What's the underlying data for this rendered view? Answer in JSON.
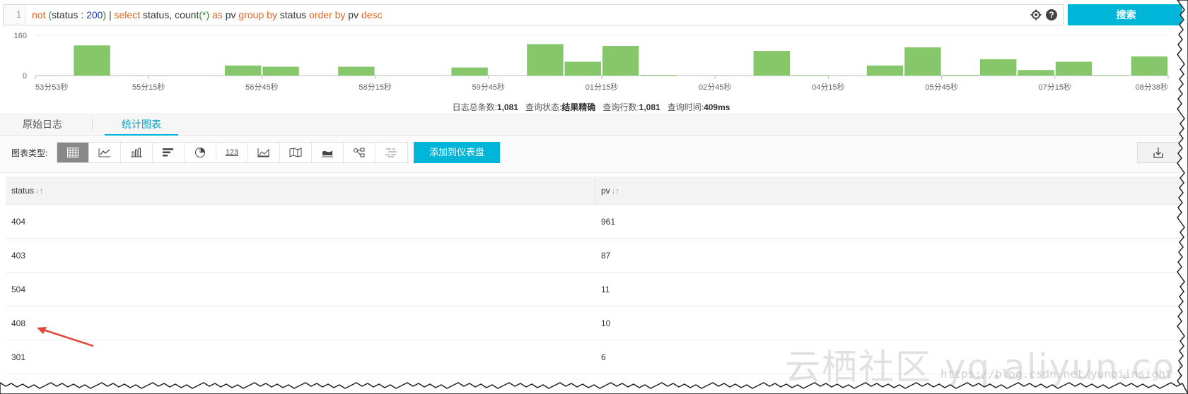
{
  "query": {
    "line_number": "1",
    "tokens": [
      {
        "t": "not",
        "c": "kw"
      },
      {
        "t": " ",
        "c": "plain"
      },
      {
        "t": "(",
        "c": "paren"
      },
      {
        "t": "status : ",
        "c": "plain"
      },
      {
        "t": "200",
        "c": "num"
      },
      {
        "t": ")",
        "c": "paren"
      },
      {
        "t": " | ",
        "c": "plain"
      },
      {
        "t": "select",
        "c": "kw"
      },
      {
        "t": " status, count",
        "c": "plain"
      },
      {
        "t": "(*)",
        "c": "star"
      },
      {
        "t": " ",
        "c": "plain"
      },
      {
        "t": "as",
        "c": "kw"
      },
      {
        "t": " pv ",
        "c": "plain"
      },
      {
        "t": "group by",
        "c": "kw"
      },
      {
        "t": " status ",
        "c": "plain"
      },
      {
        "t": "order by",
        "c": "kw"
      },
      {
        "t": " pv ",
        "c": "plain"
      },
      {
        "t": "desc",
        "c": "kw"
      }
    ],
    "help_glyph": "?"
  },
  "search_label": "搜索",
  "histogram": {
    "y_ticks": [
      "160",
      "0"
    ],
    "y_max": 160,
    "values": [
      0,
      120,
      0,
      0,
      0,
      40,
      35,
      0,
      35,
      0,
      0,
      32,
      0,
      125,
      55,
      118,
      3,
      0,
      0,
      98,
      2,
      0,
      40,
      112,
      3,
      65,
      22,
      55,
      2,
      76
    ],
    "x_labels": [
      "53分53秒",
      "55分15秒",
      "56分45秒",
      "58分15秒",
      "59分45秒",
      "01分15秒",
      "02分45秒",
      "04分15秒",
      "05分45秒",
      "07分15秒",
      "08分38秒"
    ]
  },
  "summary": {
    "count_label": "日志总条数:",
    "count_value": "1,081",
    "status_label": "查询状态:",
    "status_value": "结果精确",
    "rows_label": "查询行数:",
    "rows_value": "1,081",
    "time_label": "查询时间:",
    "time_value": "409ms"
  },
  "tabs": {
    "raw_logs": "原始日志",
    "chart": "统计图表"
  },
  "toolbar": {
    "chart_type_label": "图表类型:",
    "chart_types": [
      {
        "name": "table-icon",
        "active": true
      },
      {
        "name": "line-chart-icon",
        "active": false
      },
      {
        "name": "bar-chart-icon",
        "active": false
      },
      {
        "name": "horizontal-bar-icon",
        "active": false
      },
      {
        "name": "pie-chart-icon",
        "active": false
      },
      {
        "name": "number-icon",
        "active": false,
        "text": "123"
      },
      {
        "name": "area-chart-icon",
        "active": false
      },
      {
        "name": "map-icon",
        "active": false
      },
      {
        "name": "flow-chart-icon",
        "active": false
      },
      {
        "name": "sankey-icon",
        "active": false
      },
      {
        "name": "word-cloud-icon",
        "active": false
      }
    ],
    "add_dashboard_label": "添加到仪表盘"
  },
  "table": {
    "columns": [
      "status",
      "pv"
    ],
    "sort_glyph": "↓↑",
    "rows": [
      [
        "404",
        "961"
      ],
      [
        "403",
        "87"
      ],
      [
        "504",
        "11"
      ],
      [
        "408",
        "10"
      ],
      [
        "301",
        "6"
      ]
    ]
  },
  "watermark": {
    "main": "云栖社区 yq.aliyun.com",
    "url": "https://blog.csdn.net/yunqiinsight"
  },
  "colors": {
    "accent": "#00b6d8",
    "bar": "#86c76c",
    "arrow": "#e0463a"
  }
}
